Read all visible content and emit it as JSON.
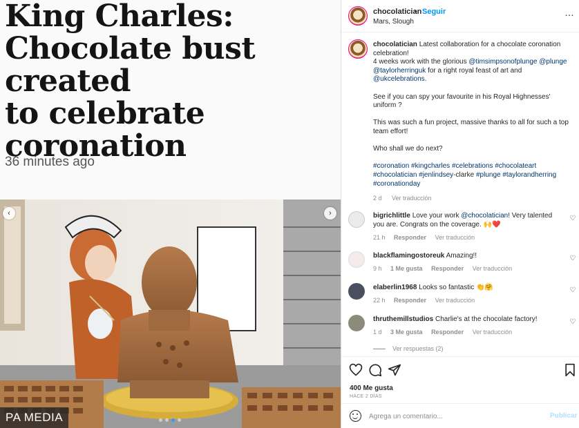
{
  "article": {
    "headline_lines": [
      "King Charles:",
      "Chocolate bust created",
      "to celebrate",
      "coronation"
    ],
    "timestamp": "36 minutes ago",
    "photo_credit": "PA MEDIA"
  },
  "post_header": {
    "username": "chocolatician",
    "separator": "•",
    "follow_label": "Seguir",
    "location": "Mars, Slough",
    "more": "…"
  },
  "caption": {
    "username": "chocolatician",
    "line1": "Latest collaboration for a chocolate coronation celebration!",
    "line2_prefix": "4 weeks work with the glorious ",
    "mentions_a": [
      "@timsimpsonofplunge",
      "@plunge",
      "@taylorherringuk"
    ],
    "line2_mid": " for a right royal feast of art and ",
    "mention_b": "@ukcelebrations",
    "line2_end": ".",
    "para2": "See if you can spy your favourite in his Royal Highnesses' uniform ?",
    "para3": "This was such a fun project, massive thanks to all for such a top team effort!",
    "para4": "Who shall we do next?",
    "hashtags_line1": "#coronation #kingcharles #celebrations #chocolateart",
    "hashtags_line2a": "#chocolatician #jenlindsey",
    "hashtags_line2b": "-clarke ",
    "hashtags_line2c": "#plunge #taylorandherring",
    "hashtags_line3": "#coronationday",
    "time": "2 d",
    "translate": "Ver traducción"
  },
  "comments": [
    {
      "username": "bigrichlittle",
      "text_a": "Love your work ",
      "mention": "@chocolatician",
      "text_b": "! Very talented you are. Congrats on the coverage. 🙌❤️",
      "time": "21 h",
      "reply": "Responder",
      "translate": "Ver traducción",
      "likes": ""
    },
    {
      "username": "blackflamingostoreuk",
      "text_a": "Amazing!!",
      "mention": "",
      "text_b": "",
      "time": "9 h",
      "likes": "1 Me gusta",
      "reply": "Responder",
      "translate": "Ver traducción"
    },
    {
      "username": "elaberlin1968",
      "text_a": "Looks so fantastic 👏🤗",
      "mention": "",
      "text_b": "",
      "time": "22 h",
      "reply": "Responder",
      "translate": "Ver traducción",
      "likes": ""
    },
    {
      "username": "thruthemillstudios",
      "text_a": "Charlie's at the chocolate factory!",
      "mention": "",
      "text_b": "",
      "time": "1 d",
      "likes": "3 Me gusta",
      "reply": "Responder",
      "translate": "Ver traducción"
    }
  ],
  "view_replies": "Ver respuestas (2)",
  "actions": {
    "icons": [
      "heart-icon",
      "comment-icon",
      "share-icon",
      "bookmark-icon"
    ],
    "likes": "400 Me gusta",
    "posted": "HACE 2 DÍAS"
  },
  "add_comment": {
    "placeholder": "Agrega un comentario...",
    "post_label": "Publicar"
  },
  "colors": {
    "link": "#00376b",
    "follow": "#0095f6",
    "post_disabled": "#b2dffc",
    "heart_red": "#ed4956"
  }
}
